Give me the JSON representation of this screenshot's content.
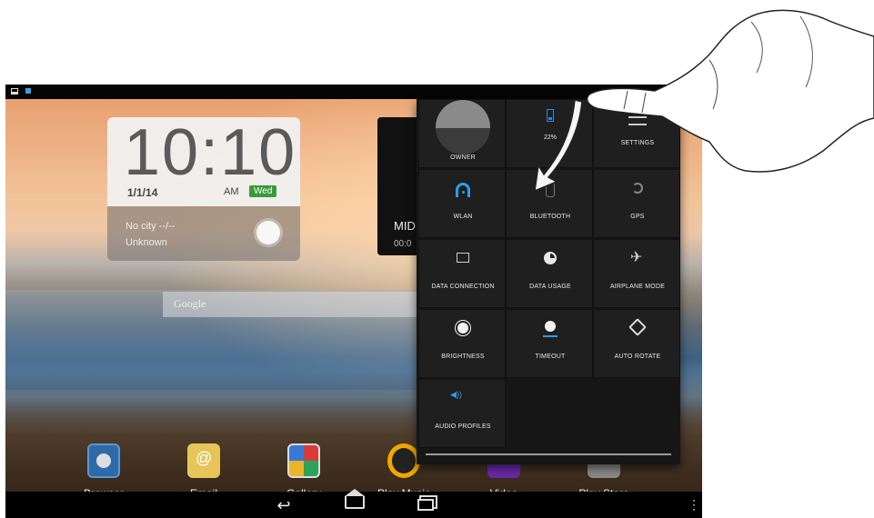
{
  "clock": {
    "time": "10:10",
    "date": "1/1/14",
    "ampm": "AM",
    "day": "Wed",
    "city": "No city --/--",
    "condition": "Unknown"
  },
  "music": {
    "title": "MID",
    "time": "00:0"
  },
  "search": {
    "placeholder": "Google"
  },
  "dock": {
    "apps": [
      {
        "label": "Browser"
      },
      {
        "label": "Email"
      },
      {
        "label": "Gallery"
      },
      {
        "label": "Play Music"
      },
      {
        "label": "Video"
      },
      {
        "label": "Play Store"
      }
    ]
  },
  "quick_settings": {
    "owner": "OWNER",
    "battery": "22%",
    "settings": "SETTINGS",
    "wlan": "WLAN",
    "bluetooth": "BLUETOOTH",
    "gps": "GPS",
    "data_connection": "DATA CONNECTION",
    "data_usage": "DATA USAGE",
    "airplane_mode": "AIRPLANE MODE",
    "brightness": "BRIGHTNESS",
    "timeout": "TIMEOUT",
    "auto_rotate": "AUTO ROTATE",
    "audio_profiles": "AUDIO PROFILES"
  },
  "colors": {
    "accent_blue": "#2f9de9",
    "day_badge": "#3a9a3a",
    "panel_bg": "#161616"
  },
  "icons": {
    "nav_back": "↩",
    "nav_menu": "⋮",
    "airplane": "✈",
    "audio": "◀))"
  }
}
